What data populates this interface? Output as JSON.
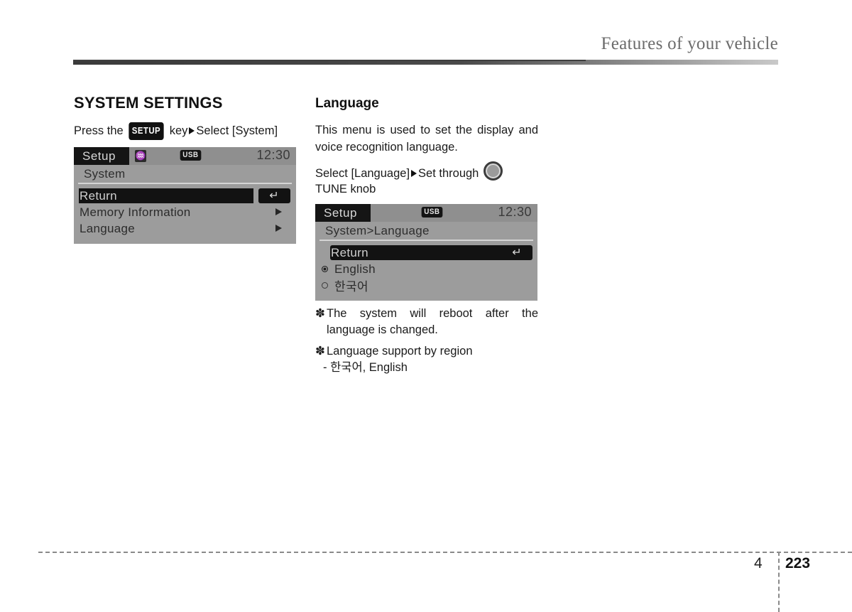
{
  "header": {
    "title": "Features of your vehicle"
  },
  "left_column": {
    "section_title": "SYSTEM SETTINGS",
    "instruction": {
      "prefix": "Press the",
      "key_badge": "SETUP",
      "middle": "key",
      "arrow_icon": "triangle-right-icon",
      "suffix": "Select [System]"
    },
    "screen": {
      "tab_label": "Setup",
      "bluetooth_icon": "bluetooth-icon",
      "usb_badge": "USB",
      "clock": "12:30",
      "breadcrumb": "System",
      "rows": [
        {
          "label": "Return",
          "type": "return",
          "highlighted": true,
          "button_icon": "return-arrow-icon"
        },
        {
          "label": "Memory Information",
          "type": "submenu",
          "highlighted": false,
          "arrow_icon": "triangle-right-icon"
        },
        {
          "label": "Language",
          "type": "submenu",
          "highlighted": false,
          "arrow_icon": "triangle-right-icon"
        }
      ]
    }
  },
  "right_column": {
    "sub_title": "Language",
    "paragraph": "This menu is used to set the display and voice recognition language.",
    "instruction": {
      "prefix": "Select  [Language]",
      "arrow_icon": "triangle-right-icon",
      "middle": "Set  through",
      "knob_icon": "tune-knob-icon",
      "suffix": "TUNE knob"
    },
    "screen": {
      "tab_label": "Setup",
      "usb_badge": "USB",
      "clock": "12:30",
      "breadcrumb": "System>Language",
      "rows": [
        {
          "label": "Return",
          "type": "return",
          "highlighted": true,
          "button_icon": "return-arrow-icon"
        },
        {
          "label": "English",
          "type": "radio",
          "selected": true
        },
        {
          "label": "한국어",
          "type": "radio",
          "selected": false
        }
      ]
    },
    "notes": [
      {
        "mark": "✽",
        "text": "The system will reboot after the language is changed."
      },
      {
        "mark": "✽",
        "text": "Language support by region"
      }
    ],
    "note_sub": "- 한국어, English"
  },
  "footer": {
    "chapter": "4",
    "page": "223"
  }
}
